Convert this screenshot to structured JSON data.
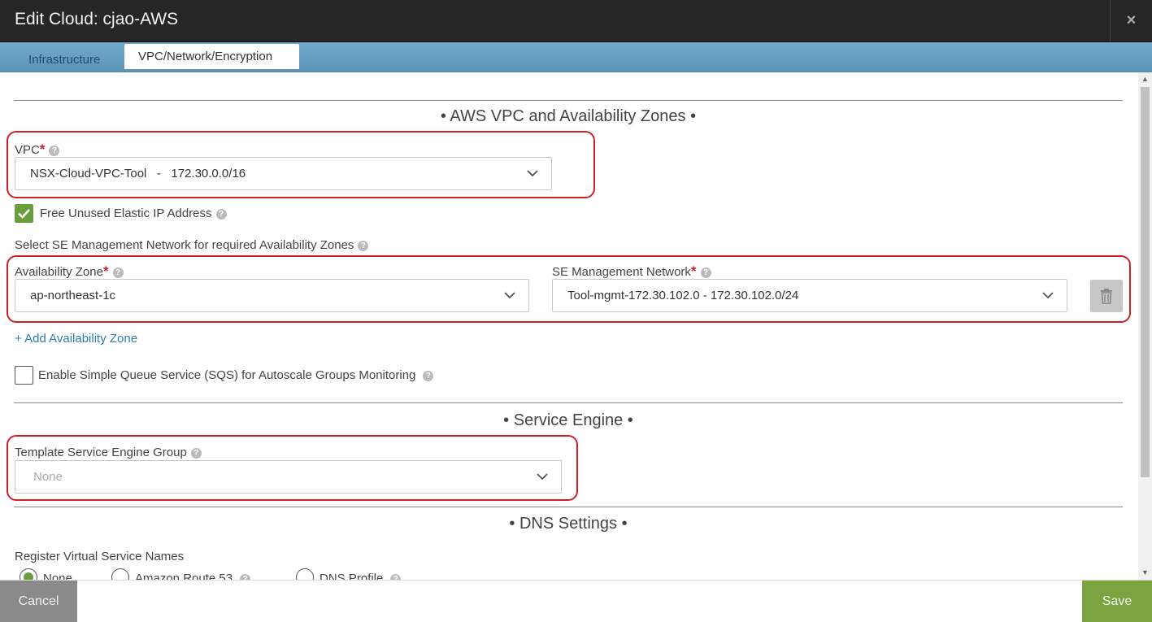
{
  "window": {
    "title": "Edit Cloud: cjao-AWS",
    "close_label": "×"
  },
  "tabs": [
    {
      "label": "Infrastructure",
      "active": false
    },
    {
      "label": "VPC/Network/Encryption",
      "active": true
    }
  ],
  "aws_section": {
    "title": "• AWS VPC and Availability Zones •",
    "vpc_label": "VPC",
    "vpc_value": "NSX-Cloud-VPC-Tool   -   172.30.0.0/16",
    "free_eip_label": "Free Unused Elastic IP Address",
    "free_eip_checked": true,
    "se_mgmt_prompt": "Select SE Management Network for required Availability Zones",
    "az_label": "Availability Zone",
    "az_value": "ap-northeast-1c",
    "se_net_label": "SE Management Network",
    "se_net_value": "Tool-mgmt-172.30.102.0 - 172.30.102.0/24",
    "add_az_link": "+ Add Availability Zone",
    "sqs_label": "Enable Simple Queue Service (SQS) for Autoscale Groups Monitoring",
    "sqs_checked": false
  },
  "se_section": {
    "title": "• Service Engine •",
    "template_label": "Template Service Engine Group",
    "template_placeholder": "None"
  },
  "dns_section": {
    "title": "• DNS Settings •",
    "register_label": "Register Virtual Service Names",
    "options": [
      "None",
      "Amazon Route 53",
      "DNS Profile"
    ],
    "selected": "None"
  },
  "footer": {
    "cancel_label": "Cancel",
    "save_label": "Save"
  },
  "colors": {
    "accent_green": "#7ba441",
    "highlight_red": "#cf2027",
    "tab_blue": "#5b95b8"
  }
}
